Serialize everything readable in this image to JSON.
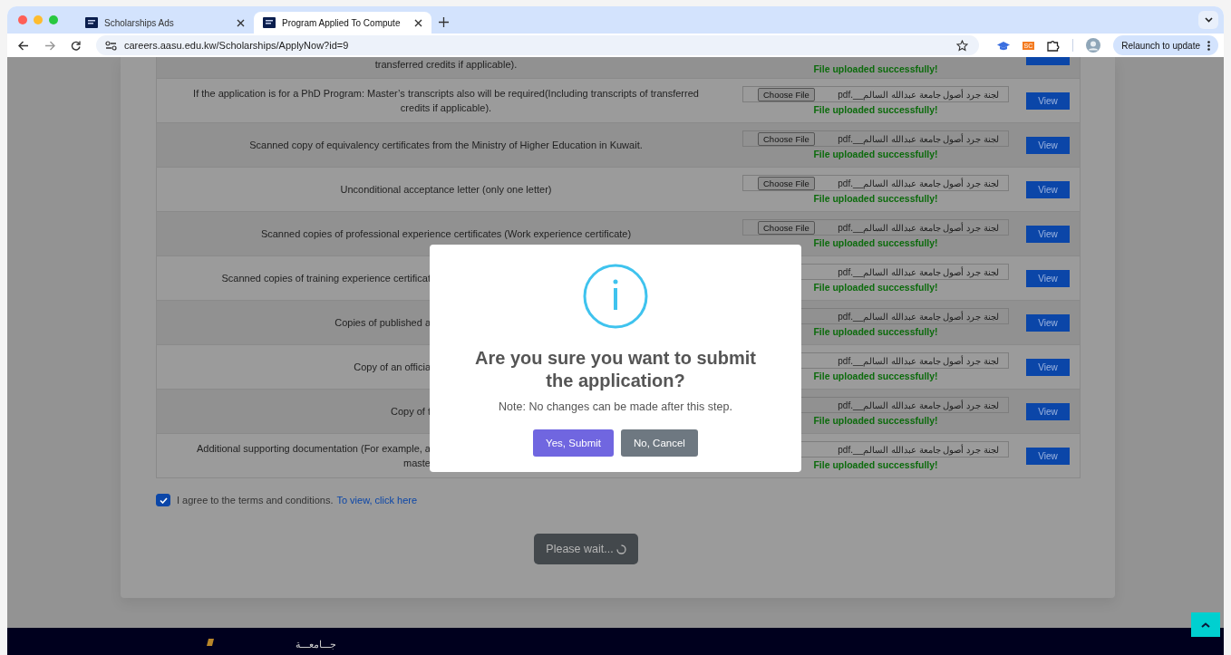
{
  "browser": {
    "tabs": [
      {
        "title": "Scholarships Ads",
        "selected": false
      },
      {
        "title": "Program Applied To Compute",
        "selected": true
      }
    ],
    "url": "careers.aasu.edu.kw/Scholarships/ApplyNow?id=9",
    "extension_badge": "SC",
    "relaunch": "Relaunch to update"
  },
  "documents": [
    {
      "description": [
        "transferred credits if applicable)."
      ],
      "status": "File uploaded successfully!"
    },
    {
      "description": [
        "If the application is for a PhD Program: Master’s transcripts also will be required(Including transcripts of transferred",
        "credits if applicable)."
      ],
      "file": {
        "choose_label": "Choose File",
        "filename": "لجنة جرد أصول جامعة عبدالله السالم__.pdf"
      },
      "status": "File uploaded successfully!",
      "view": "View"
    },
    {
      "description": [
        "Scanned copy of equivalency certificates from the Ministry of Higher Education in Kuwait."
      ],
      "file": {
        "choose_label": "Choose File",
        "filename": "لجنة جرد أصول جامعة عبدالله السالم__.pdf"
      },
      "status": "File uploaded successfully!",
      "view": "View"
    },
    {
      "description": [
        "Unconditional acceptance letter (only one letter)"
      ],
      "file": {
        "choose_label": "Choose File",
        "filename": "لجنة جرد أصول جامعة عبدالله السالم__.pdf"
      },
      "status": "File uploaded successfully!",
      "view": "View"
    },
    {
      "description": [
        "Scanned copies of professional experience certificates (Work experience certificate)"
      ],
      "file": {
        "choose_label": "Choose File",
        "filename": "لجنة جرد أصول جامعة عبدالله السالم__.pdf"
      },
      "status": "File uploaded successfully!",
      "view": "View"
    },
    {
      "description": [
        "Scanned copies of training experience certificat"
      ],
      "file": {
        "filename": "لجنة جرد أصول جامعة عبدالله السالم__.pdf"
      },
      "status": "File uploaded successfully!",
      "view": "View"
    },
    {
      "description": [
        "Copies of published a"
      ],
      "file": {
        "filename": "لجنة جرد أصول جامعة عبدالله السالم__.pdf"
      },
      "status": "File uploaded successfully!",
      "view": "View"
    },
    {
      "description": [
        "Copy of an officia"
      ],
      "file": {
        "filename": "لجنة جرد أصول جامعة عبدالله السالم__.pdf"
      },
      "status": "File uploaded successfully!",
      "view": "View"
    },
    {
      "description": [
        "Copy of t"
      ],
      "file": {
        "filename": "لجنة جرد أصول جامعة عبدالله السالم__.pdf"
      },
      "status": "File uploaded successfully!",
      "view": "View"
    },
    {
      "description": [
        "Additional supporting documentation (For example, a",
        "maste"
      ],
      "file": {
        "filename": "لجنة جرد أصول جامعة عبدالله السالم__.pdf"
      },
      "status": "File uploaded successfully!",
      "view": "View"
    }
  ],
  "terms": {
    "checked": true,
    "text": "I agree to the terms and conditions.",
    "link": "To view, click here"
  },
  "submit_button": "Please wait...",
  "footer": {
    "logo_text": "جـــامعـــة"
  },
  "dialog": {
    "title": "Are you sure you want to submit the application?",
    "note": "Note: No changes can be made after this step.",
    "buttons": [
      {
        "label": "Yes, Submit",
        "kind": "confirm"
      },
      {
        "label": "No, Cancel",
        "kind": "cancel"
      }
    ]
  }
}
